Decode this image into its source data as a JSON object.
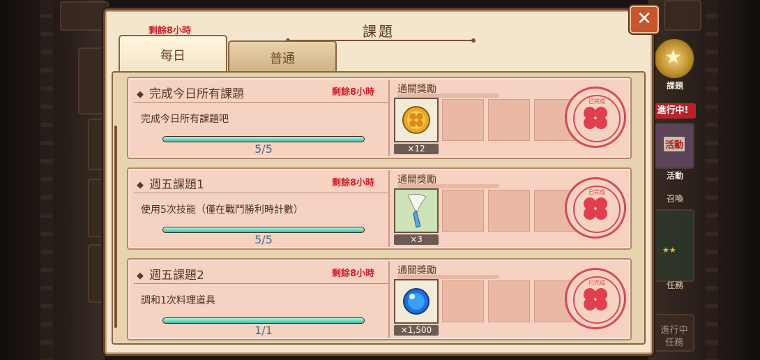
{
  "panel": {
    "title": "課題",
    "close_glyph": "✕"
  },
  "tabs": {
    "note": "剩餘8小時",
    "items": [
      {
        "label": "每日",
        "active": true
      },
      {
        "label": "普通",
        "active": false
      }
    ]
  },
  "quests": [
    {
      "name": "完成今日所有課題",
      "time_left": "剩餘8小時",
      "description": "完成今日所有課題吧",
      "progress": 1.0,
      "progress_text": "5/5",
      "reward_label": "通關獎勵",
      "reward_item": "gold-coin-icon",
      "reward_qty": "×12",
      "stamp_text": "已完成"
    },
    {
      "name": "週五課題1",
      "time_left": "剩餘8小時",
      "description": "使用5次技能（僅在戰鬥勝利時計數）",
      "progress": 1.0,
      "progress_text": "5/5",
      "reward_label": "通關獎勵",
      "reward_item": "feather-key-icon",
      "reward_stars": "★★",
      "reward_qty": "×3",
      "stamp_text": "已完成"
    },
    {
      "name": "週五課題2",
      "time_left": "剩餘8小時",
      "description": "調和1次料理道具",
      "progress": 1.0,
      "progress_text": "1/1",
      "reward_label": "通關獎勵",
      "reward_item": "blue-orb-icon",
      "reward_qty": "×1,500",
      "stamp_text": "已完成"
    }
  ],
  "side": {
    "quests_label": "課題",
    "in_progress_badge": "進行中!",
    "event_label": "活動",
    "event_icon_text": "活動",
    "summon_label": "召喚",
    "task_label": "任務",
    "bottom_in_progress": "進行中",
    "bottom_task": "任務"
  }
}
